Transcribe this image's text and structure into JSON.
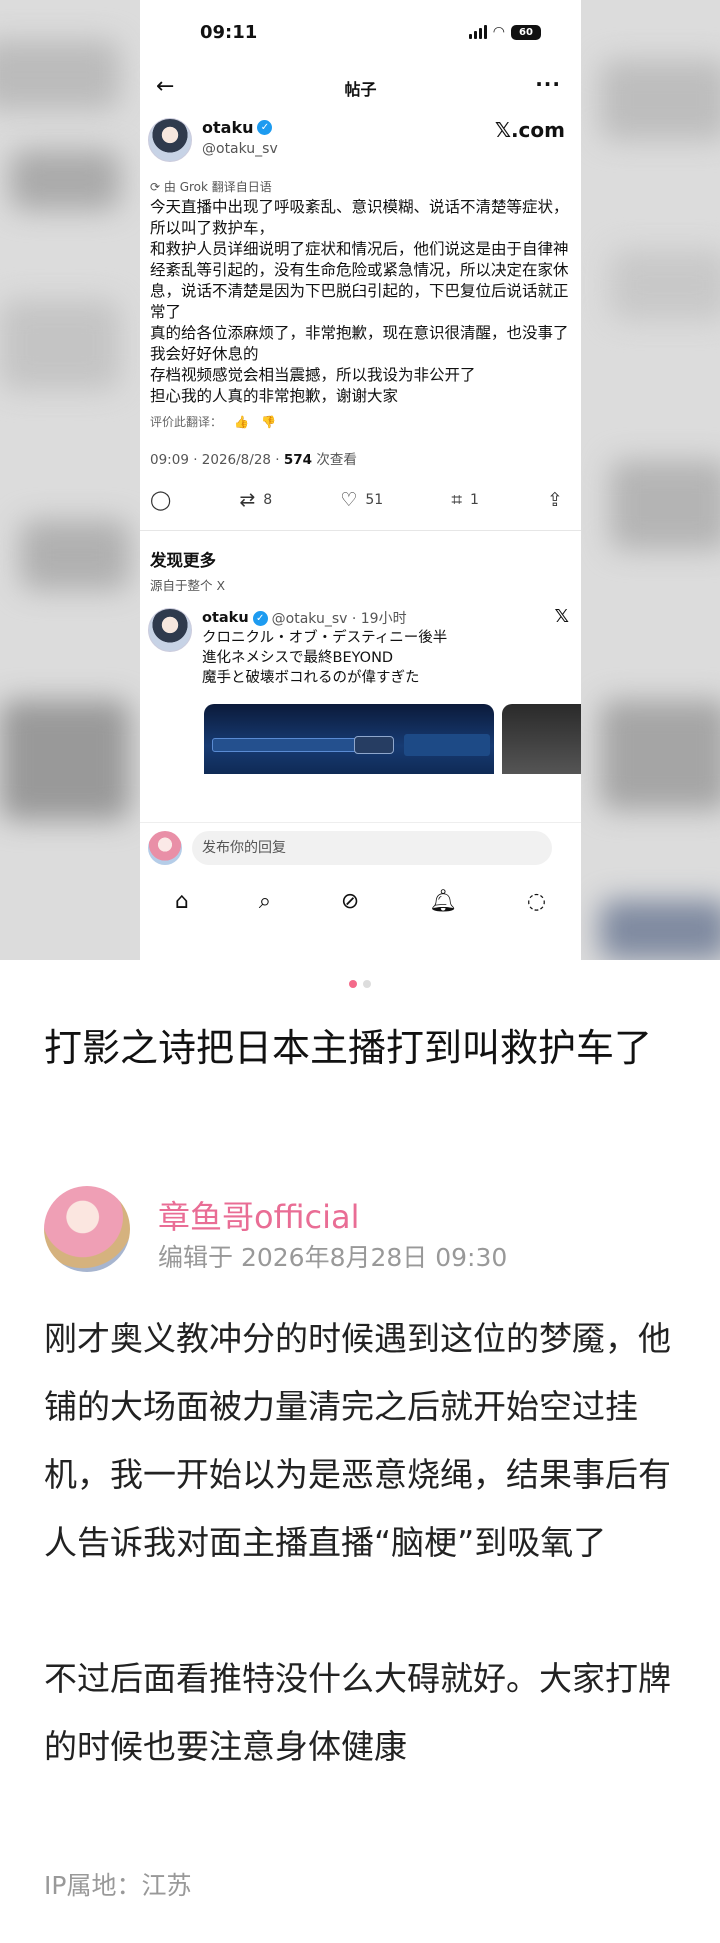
{
  "screenshot": {
    "status_time": "09:11",
    "battery": "60",
    "header_title": "帖子",
    "back_icon": "arrow-left-icon",
    "more_icon": "more-icon",
    "author_name": "otaku",
    "author_handle": "@otaku_sv",
    "brand": "𝕏.com",
    "translate_note": "由 Grok 翻译自日语",
    "tweet_text": "今天直播中出现了呼吸紊乱、意识模糊、说话不清楚等症状，所以叫了救护车，\n和救护人员详细说明了症状和情况后，他们说这是由于自律神经紊乱等引起的，没有生命危险或紧急情况，所以决定在家休息，说话不清楚是因为下巴脱臼引起的，下巴复位后说话就正常了\n真的给各位添麻烦了，非常抱歉，现在意识很清醒，也没事了\n我会好好休息的\n存档视频感觉会相当震撼，所以我设为非公开了\n担心我的人真的非常抱歉，谢谢大家",
    "rate_label": "评价此翻译：",
    "timestamp": "09:09 · 2026/8/28 · ",
    "views_count": "574",
    "views_label": " 次查看",
    "retweets": "8",
    "likes": "51",
    "bookmarks": "1",
    "discover_title": "发现更多",
    "discover_sub": "源自于整个 X",
    "rec_name": "otaku",
    "rec_handle_time": "@otaku_sv · 19小时",
    "rec_text": "クロニクル・オブ・デスティニー後半\n進化ネメシスで最終BEYOND\n魔手と破壊ボコれるのが偉すぎた",
    "reply_placeholder": "发布你的回复"
  },
  "carousel": {
    "count": 2,
    "active": 1
  },
  "post": {
    "title": "打影之诗把日本主播打到叫救护车了",
    "author": "章鱼哥official",
    "edited": "编辑于 2026年8月28日 09:30",
    "body": "刚才奥义教冲分的时候遇到这位的梦魇，他铺的大场面被力量清完之后就开始空过挂机，我一开始以为是恶意烧绳，结果事后有人告诉我对面主播直播“脑梗”到吸氧了\n\n不过后面看推特没什么大碍就好。大家打牌的时候也要注意身体健康",
    "ip": "IP属地：江苏"
  },
  "colors": {
    "accent": "#e96d95",
    "verified": "#1d9bf0"
  }
}
